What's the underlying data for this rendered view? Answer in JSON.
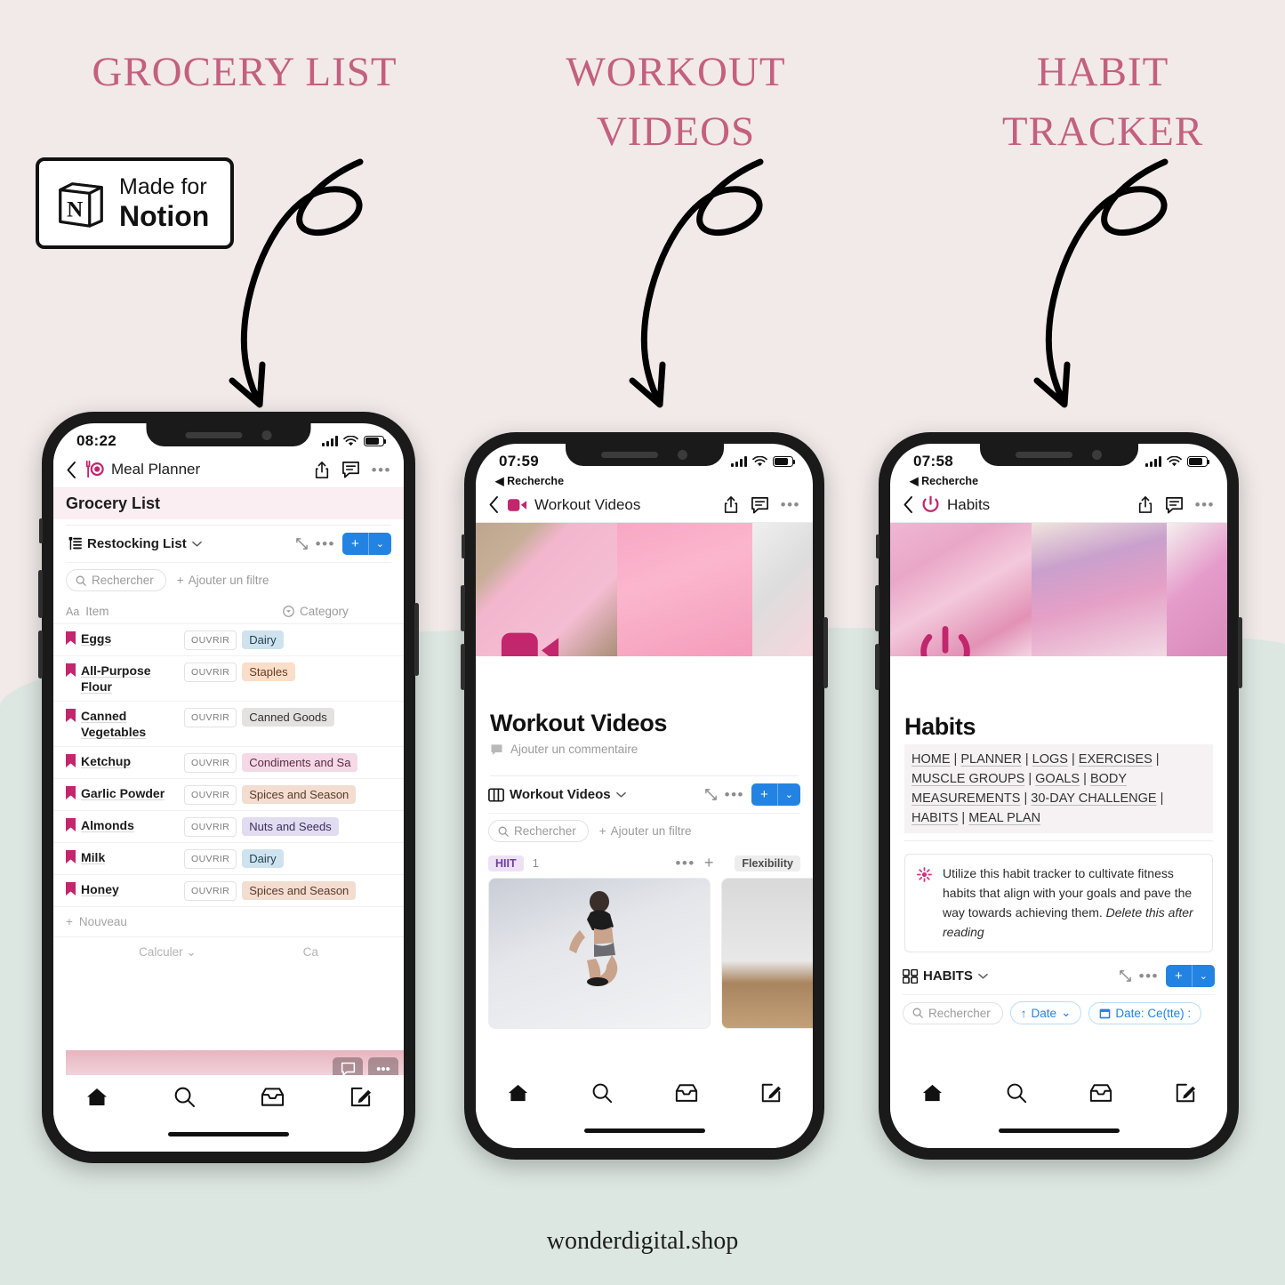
{
  "background": {
    "top_color": "#f1eae9",
    "bottom_color": "#dde7e2",
    "accent_pink": "#c4607f"
  },
  "headings": [
    {
      "text": "Grocery List"
    },
    {
      "text": "Workout Videos"
    },
    {
      "text": "Habit Tracker"
    }
  ],
  "notion_badge": {
    "line1": "Made for",
    "line2": "Notion",
    "icon": "notion-cube-icon"
  },
  "footer": {
    "text": "wonderdigital.shop"
  },
  "phones": [
    {
      "id": "grocery",
      "status": {
        "time": "08:22",
        "back_label": "",
        "signal_icon": "cellular-bars-icon",
        "wifi_icon": "wifi-icon",
        "battery_icon": "battery-icon"
      },
      "nav": {
        "back_icon": "chevron-left-icon",
        "emoji": "fork-plate-icon",
        "title": "Meal Planner",
        "share_icon": "share-icon",
        "comment_icon": "comment-icon",
        "more_icon": "more-dots-icon"
      },
      "page_heading": "Grocery List",
      "database": {
        "icon": "restock-list-icon",
        "title": "Restocking List",
        "chevron": "chevron-down-icon",
        "expand_icon": "expand-icon",
        "more_icon": "more-dots-icon",
        "add_label": "+",
        "add_chevron": "⌄"
      },
      "filters": {
        "search_placeholder": "Rechercher",
        "search_icon": "search-icon",
        "add_filter": "Ajouter un filtre"
      },
      "columns": [
        {
          "icon": "aa-text-icon",
          "label": "Item"
        },
        {
          "icon": "select-circle-icon",
          "label": "Category"
        }
      ],
      "open_label": "OUVRIR",
      "rows": [
        {
          "name": "Eggs",
          "tag": "Dairy",
          "tag_bg": "#cfe3ef",
          "tag_fg": "#1f3f51"
        },
        {
          "name": "All-Purpose Flour",
          "tag": "Staples",
          "tag_bg": "#fadec9",
          "tag_fg": "#693b20"
        },
        {
          "name": "Canned Vegetables",
          "tag": "Canned Goods",
          "tag_bg": "#e3e2e0",
          "tag_fg": "#32302c"
        },
        {
          "name": "Ketchup",
          "tag": "Condiments and Sa",
          "tag_bg": "#f5d9e6",
          "tag_fg": "#5a2a42"
        },
        {
          "name": "Garlic Powder",
          "tag": "Spices and Season",
          "tag_bg": "#f3dcd0",
          "tag_fg": "#5c3a28"
        },
        {
          "name": "Almonds",
          "tag": "Nuts and Seeds",
          "tag_bg": "#e2dcf0",
          "tag_fg": "#3c2e60"
        },
        {
          "name": "Milk",
          "tag": "Dairy",
          "tag_bg": "#cfe3ef",
          "tag_fg": "#1f3f51"
        },
        {
          "name": "Honey",
          "tag": "Spices and Season",
          "tag_bg": "#f3dcd0",
          "tag_fg": "#5c3a28"
        }
      ],
      "new_row_label": "Nouveau",
      "calc_left": "Calculer",
      "calc_right": "Ca",
      "tabbar": [
        "home-icon",
        "search-icon",
        "inbox-icon",
        "compose-icon"
      ]
    },
    {
      "id": "workout",
      "status": {
        "time": "07:59",
        "back_label": "Recherche"
      },
      "nav": {
        "emoji": "video-camera-icon",
        "title": "Workout Videos"
      },
      "page_title": "Workout Videos",
      "add_comment": "Ajouter un commentaire",
      "database": {
        "icon": "board-view-icon",
        "title": "Workout Videos"
      },
      "filters": {
        "search_placeholder": "Rechercher",
        "add_filter": "Ajouter un filtre"
      },
      "board": [
        {
          "label": "HIIT",
          "count": "1",
          "pill_bg": "#eee0f6",
          "pill_fg": "#6a3fa0"
        },
        {
          "label": "Flexibility",
          "count": "",
          "pill_bg": "#ededed",
          "pill_fg": "#4b4b4b"
        }
      ],
      "tabbar": [
        "home-icon",
        "search-icon",
        "inbox-icon",
        "compose-icon"
      ]
    },
    {
      "id": "habits",
      "status": {
        "time": "07:58",
        "back_label": "Recherche"
      },
      "nav": {
        "emoji": "power-button-icon",
        "title": "Habits"
      },
      "page_title": "Habits",
      "links": [
        "HOME",
        "PLANNER",
        "LOGS",
        "EXERCISES",
        "MUSCLE GROUPS",
        "GOALS",
        "BODY MEASUREMENTS",
        "30-DAY CHALLENGE",
        "HABITS",
        "MEAL PLAN"
      ],
      "links_raw_lines": [
        "HOME | PLANNER | LOGS | EXERCISES |",
        "MUSCLE GROUPS | GOALS | BODY",
        "MEASUREMENTS | 30-DAY CHALLENGE |",
        "HABITS | MEAL PLAN"
      ],
      "callout": {
        "icon": "flower-icon",
        "text": "Utilize this habit tracker to cultivate fitness habits that align with your goals and pave the way towards achieving them. ",
        "emphasis": "Delete this after reading"
      },
      "database": {
        "icon": "gallery-view-icon",
        "title": "HABITS"
      },
      "filters": {
        "search_placeholder": "Rechercher",
        "sort_label": "Date",
        "sort_icon": "arrow-up-icon",
        "date_filter_label": "Date: Ce(tte) :",
        "date_filter_icon": "calendar-icon"
      },
      "tabbar": [
        "home-icon",
        "search-icon",
        "inbox-icon",
        "compose-icon"
      ]
    }
  ]
}
